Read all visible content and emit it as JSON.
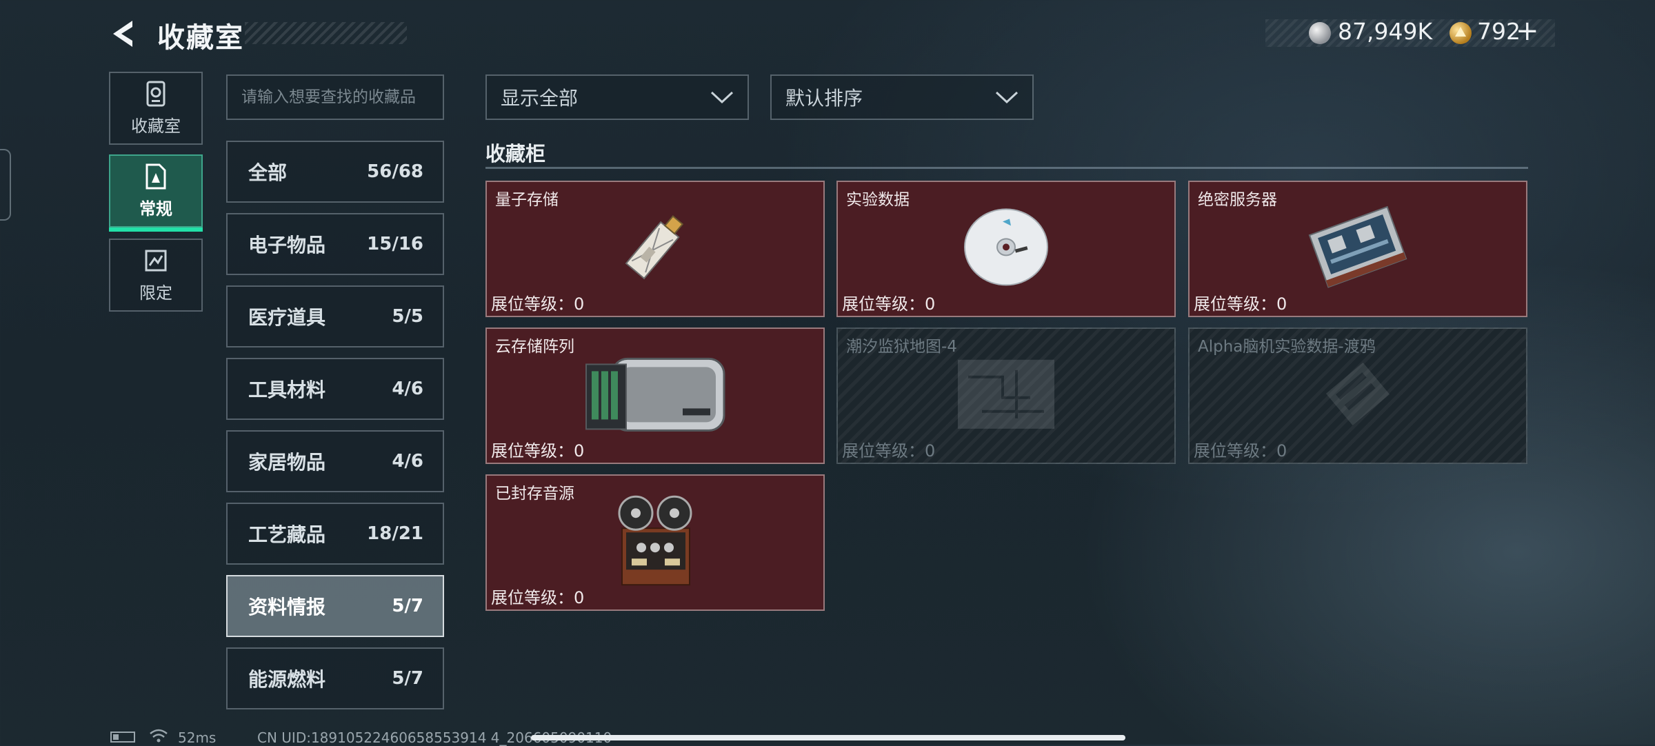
{
  "header": {
    "title": "收藏室"
  },
  "currency": {
    "silver": "87,949K",
    "gold": "792",
    "add": "+"
  },
  "nav": [
    {
      "label": "收藏室",
      "icon": "collection-icon",
      "active": false
    },
    {
      "label": "常规",
      "icon": "regular-icon",
      "active": true
    },
    {
      "label": "限定",
      "icon": "limited-icon",
      "active": false
    }
  ],
  "search": {
    "placeholder": "请输入想要查找的收藏品"
  },
  "categories": [
    {
      "name": "全部",
      "count": "56/68"
    },
    {
      "name": "电子物品",
      "count": "15/16"
    },
    {
      "name": "医疗道具",
      "count": "5/5"
    },
    {
      "name": "工具材料",
      "count": "4/6"
    },
    {
      "name": "家居物品",
      "count": "4/6"
    },
    {
      "name": "工艺藏品",
      "count": "18/21"
    },
    {
      "name": "资料情报",
      "count": "5/7",
      "selected": true
    },
    {
      "name": "能源燃料",
      "count": "5/7"
    }
  ],
  "filters": {
    "display": "显示全部",
    "sort": "默认排序"
  },
  "section": {
    "title": "收藏柜"
  },
  "items": [
    {
      "name": "量子存储",
      "level": "展位等级：0",
      "icon": "quantum-storage-icon",
      "locked": false
    },
    {
      "name": "实验数据",
      "level": "展位等级：0",
      "icon": "data-disc-icon",
      "locked": false
    },
    {
      "name": "绝密服务器",
      "level": "展位等级：0",
      "icon": "server-icon",
      "locked": false
    },
    {
      "name": "云存储阵列",
      "level": "展位等级：0",
      "icon": "storage-array-icon",
      "locked": false
    },
    {
      "name": "潮汐监狱地图-4",
      "level": "展位等级：0",
      "icon": "map-icon",
      "locked": true
    },
    {
      "name": "Alpha脑机实验数据-渡鸦",
      "level": "展位等级：0",
      "icon": "data-drive-icon",
      "locked": true
    },
    {
      "name": "已封存音源",
      "level": "展位等级：0",
      "icon": "reel-recorder-icon",
      "locked": false
    }
  ],
  "status": {
    "ping": "52ms",
    "uid": "CN UID:18910522460658553914 4_206605090110"
  }
}
